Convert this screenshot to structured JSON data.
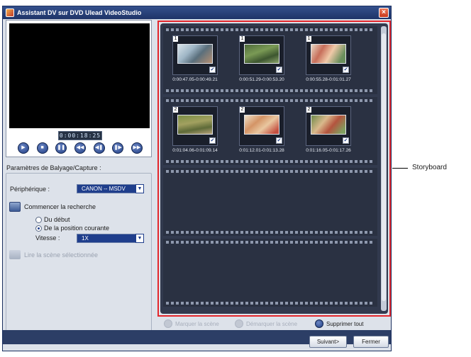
{
  "window": {
    "title": "Assistant DV sur DVD Ulead VideoStudio"
  },
  "preview": {
    "timecode": "0:00:18:25"
  },
  "playback_controls": [
    {
      "name": "play-button",
      "icon": "▶"
    },
    {
      "name": "stop-button",
      "icon": "■"
    },
    {
      "name": "pause-button",
      "icon": "❚❚"
    },
    {
      "name": "rewind-button",
      "icon": "◀◀"
    },
    {
      "name": "previous-frame-button",
      "icon": "◀❚"
    },
    {
      "name": "next-frame-button",
      "icon": "❚▶"
    },
    {
      "name": "fast-forward-button",
      "icon": "▶▶"
    }
  ],
  "scan": {
    "section_label": "Paramètres de Balyage/Capture :",
    "device_label": "Périphérique :",
    "device_value": "CANON -- MSDV",
    "search_label": "Commencer la recherche",
    "option_start": "Du début",
    "option_current": "De la position courante",
    "selected_option": "option_current",
    "speed_label": "Vitesse :",
    "speed_value": "1X",
    "play_selected_label": "Lire la scène sélectionnée"
  },
  "storyboard": {
    "clips": [
      {
        "number": "1",
        "time": "0:00:47.05-0:00:49.21",
        "checked": true
      },
      {
        "number": "1",
        "time": "0:00:51.29-0:00:53.20",
        "checked": true
      },
      {
        "number": "1",
        "time": "0:00:55.28-0:01:01.27",
        "checked": true
      },
      {
        "number": "2",
        "time": "0:01:04.06-0:01:09.14",
        "checked": true
      },
      {
        "number": "2",
        "time": "0:01:12.01-0:01:13.28",
        "checked": true
      },
      {
        "number": "2",
        "time": "0:01:16.05-0:01:17.26",
        "checked": true
      }
    ]
  },
  "actions": {
    "mark_scene": "Marquer la scène",
    "unmark_scene": "Démarquer la scène",
    "delete_all": "Supprimer tout"
  },
  "buttons": {
    "next": "Suivant>",
    "close": "Fermer"
  },
  "callout": {
    "label": "Storyboard"
  },
  "colors": {
    "accent": "#1f3e8c",
    "highlight_border": "#e3262c",
    "storyboard_bg": "#323a4e"
  }
}
